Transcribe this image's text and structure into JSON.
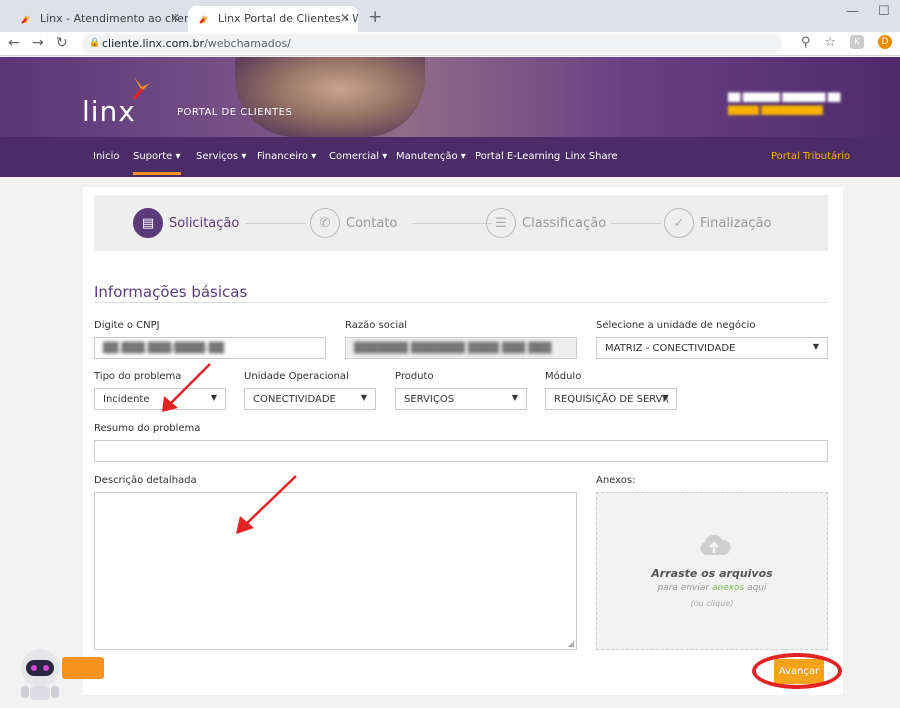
{
  "browser": {
    "tabs": [
      {
        "title": "Linx - Atendimento ao cliente",
        "active": false
      },
      {
        "title": "Linx Portal de Clientes › Webchar",
        "active": true
      }
    ],
    "url_host": "cliente.linx.com.br",
    "url_path": "/webchamados/",
    "profile_initial": "D"
  },
  "header": {
    "logo": "linx",
    "portal_label": "PORTAL DE CLIENTES"
  },
  "nav": {
    "items": [
      {
        "label": "Inicio"
      },
      {
        "label": "Suporte ▾"
      },
      {
        "label": "Serviços ▾"
      },
      {
        "label": "Financeiro ▾"
      },
      {
        "label": "Comercial ▾"
      },
      {
        "label": "Manutenção ▾"
      },
      {
        "label": "Portal E-Learning"
      },
      {
        "label": "Linx Share"
      }
    ],
    "right_link": "Portal Tributário"
  },
  "steps": [
    {
      "label": "Solicitação",
      "active": true
    },
    {
      "label": "Contato",
      "active": false
    },
    {
      "label": "Classificação",
      "active": false
    },
    {
      "label": "Finalização",
      "active": false
    }
  ],
  "form": {
    "section_title": "Informações básicas",
    "cnpj_label": "Digite o CNPJ",
    "razao_label": "Razão social",
    "unidade_negocio_label": "Selecione a unidade de negócio",
    "unidade_negocio_value": "MATRIZ - CONECTIVIDADE",
    "tipo_label": "Tipo do problema",
    "tipo_value": "Incidente",
    "unidade_op_label": "Unidade Operacional",
    "unidade_op_value": "CONECTIVIDADE",
    "produto_label": "Produto",
    "produto_value": "SERVIÇOS",
    "modulo_label": "Módulo",
    "modulo_value": "REQUISIÇÃO DE SERVI(",
    "resumo_label": "Resumo do problema",
    "descricao_label": "Descrição detalhada",
    "anexos_label": "Anexos:"
  },
  "dropzone": {
    "title": "Arraste os arquivos",
    "line2_a": "para enviar ",
    "line2_b": "anexos",
    "line2_c": " aqui",
    "line3": "(ou clique)"
  },
  "actions": {
    "next_label": "Avançar"
  },
  "colors": {
    "brand_purple": "#4b2c67",
    "accent_orange": "#f7a21b",
    "annotation_red": "#e52222"
  }
}
